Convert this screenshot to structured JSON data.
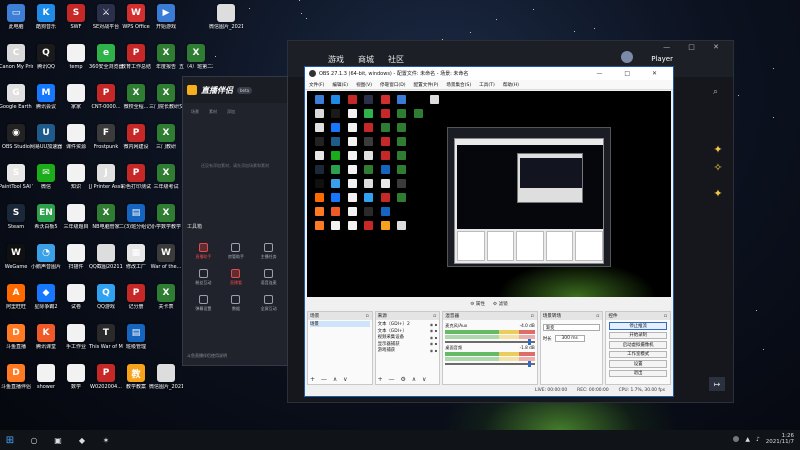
{
  "desktop": {
    "icons": [
      {
        "label": "此电脑",
        "color": "#3d7fd6",
        "glyph": "▭"
      },
      {
        "label": "酷狗音乐",
        "color": "#1e8be8",
        "glyph": "K"
      },
      {
        "label": "SWF",
        "color": "#c62828",
        "glyph": "S"
      },
      {
        "label": "SE对战平台",
        "color": "#2b2f4a",
        "glyph": "⚔"
      },
      {
        "label": "WPS Office",
        "color": "#d32f2f",
        "glyph": "W"
      },
      {
        "label": "开始游戏",
        "color": "#3a7bd5",
        "glyph": "▶"
      },
      {
        "label": "",
        "color": "#00000000",
        "glyph": ""
      },
      {
        "label": "微信图片_2021042...",
        "color": "#dddddd",
        "glyph": ""
      },
      {
        "label": "Canon My Printer",
        "color": "#d9d9d9",
        "glyph": "C"
      },
      {
        "label": "腾讯QQ",
        "color": "#1a1a1a",
        "glyph": "Q"
      },
      {
        "label": "temp",
        "color": "#f2f2f2",
        "glyph": ""
      },
      {
        "label": "360安全浏览器",
        "color": "#2fb24a",
        "glyph": "e"
      },
      {
        "label": "教育工作总结",
        "color": "#c62828",
        "glyph": "P"
      },
      {
        "label": "年度报告",
        "color": "#2e7d32",
        "glyph": "X"
      },
      {
        "label": "五（4）班第二次考试",
        "color": "#2e7d32",
        "glyph": "X"
      },
      {
        "label": "",
        "color": "#00000000",
        "glyph": ""
      },
      {
        "label": "Google Earth Pro",
        "color": "#e0e0e0",
        "glyph": "G"
      },
      {
        "label": "腾讯会议",
        "color": "#1677ff",
        "glyph": "M"
      },
      {
        "label": "家家",
        "color": "#f2f2f2",
        "glyph": ""
      },
      {
        "label": "CNT-0000...",
        "color": "#c62828",
        "glyph": "P"
      },
      {
        "label": "微校全程...",
        "color": "#2e7d32",
        "glyph": "X"
      },
      {
        "label": "三门院长教研交流",
        "color": "#2e7d32",
        "glyph": "X"
      },
      {
        "label": "",
        "color": "#00000000",
        "glyph": ""
      },
      {
        "label": "",
        "color": "#00000000",
        "glyph": ""
      },
      {
        "label": "OBS Studio",
        "color": "#222222",
        "glyph": "◉"
      },
      {
        "label": "网易UU加速器",
        "color": "#1e5a8a",
        "glyph": "U"
      },
      {
        "label": "课件资源",
        "color": "#f2f2f2",
        "glyph": ""
      },
      {
        "label": "Frostpunk",
        "color": "#3b3b3b",
        "glyph": "F"
      },
      {
        "label": "微内网建设",
        "color": "#c62828",
        "glyph": "P"
      },
      {
        "label": "三门教研",
        "color": "#2e7d32",
        "glyph": "X"
      },
      {
        "label": "",
        "color": "#00000000",
        "glyph": ""
      },
      {
        "label": "",
        "color": "#00000000",
        "glyph": ""
      },
      {
        "label": "PaintTool SAI Ver.1",
        "color": "#e7e7e7",
        "glyph": "S"
      },
      {
        "label": "微信",
        "color": "#1aad19",
        "glyph": "✉"
      },
      {
        "label": "知识",
        "color": "#f2f2f2",
        "glyph": ""
      },
      {
        "label": "JJ Printer Assista...",
        "color": "#e0e0e0",
        "glyph": "J"
      },
      {
        "label": "彩色打印测试",
        "color": "#c62828",
        "glyph": "P"
      },
      {
        "label": "三年级考试",
        "color": "#2e7d32",
        "glyph": "X"
      },
      {
        "label": "",
        "color": "#00000000",
        "glyph": ""
      },
      {
        "label": "",
        "color": "#00000000",
        "glyph": ""
      },
      {
        "label": "Steam",
        "color": "#1b2838",
        "glyph": "S"
      },
      {
        "label": "希沃白板5",
        "color": "#2ca04a",
        "glyph": "EN"
      },
      {
        "label": "三年级题目",
        "color": "#f2f2f2",
        "glyph": ""
      },
      {
        "label": "NB电脑管家",
        "color": "#2e7d32",
        "glyph": "X"
      },
      {
        "label": "二(3)班分组记录",
        "color": "#1565c0",
        "glyph": "▤"
      },
      {
        "label": "小学数学教学",
        "color": "#2e7d32",
        "glyph": "X"
      },
      {
        "label": "",
        "color": "#00000000",
        "glyph": ""
      },
      {
        "label": "",
        "color": "#00000000",
        "glyph": ""
      },
      {
        "label": "WeGame",
        "color": "#101010",
        "glyph": "W"
      },
      {
        "label": "小鹅声音图片",
        "color": "#3aa0e8",
        "glyph": "◔"
      },
      {
        "label": "扫描件",
        "color": "#f2f2f2",
        "glyph": ""
      },
      {
        "label": "QQ截图20211103...",
        "color": "#dddddd",
        "glyph": ""
      },
      {
        "label": "修改工厂",
        "color": "#e6e6e6",
        "glyph": "▦"
      },
      {
        "label": "War of the...",
        "color": "#3b3b3b",
        "glyph": "W"
      },
      {
        "label": "",
        "color": "#00000000",
        "glyph": ""
      },
      {
        "label": "",
        "color": "#00000000",
        "glyph": ""
      },
      {
        "label": "阿里旺旺",
        "color": "#ff6a00",
        "glyph": "A"
      },
      {
        "label": "星际争霸2",
        "color": "#1677ff",
        "glyph": "◆"
      },
      {
        "label": "试卷",
        "color": "#f2f2f2",
        "glyph": ""
      },
      {
        "label": "QQ游戏",
        "color": "#2fa3f2",
        "glyph": "Q"
      },
      {
        "label": "记分册",
        "color": "#c62828",
        "glyph": "P"
      },
      {
        "label": "关卡表",
        "color": "#2e7d32",
        "glyph": "X"
      },
      {
        "label": "",
        "color": "#00000000",
        "glyph": ""
      },
      {
        "label": "",
        "color": "#00000000",
        "glyph": ""
      },
      {
        "label": "斗鱼直播",
        "color": "#ff7a22",
        "glyph": "D"
      },
      {
        "label": "腾讯课堂",
        "color": "#f05a28",
        "glyph": "K"
      },
      {
        "label": "手工作业",
        "color": "#f2f2f2",
        "glyph": ""
      },
      {
        "label": "This War of Mine",
        "color": "#2a2a2a",
        "glyph": "T"
      },
      {
        "label": "班级管理",
        "color": "#1565c0",
        "glyph": "▤"
      },
      {
        "label": "",
        "color": "#00000000",
        "glyph": ""
      },
      {
        "label": "",
        "color": "#00000000",
        "glyph": ""
      },
      {
        "label": "",
        "color": "#00000000",
        "glyph": ""
      },
      {
        "label": "斗鱼直播伴侣",
        "color": "#ff7a22",
        "glyph": "D"
      },
      {
        "label": "shower",
        "color": "#f2f2f2",
        "glyph": ""
      },
      {
        "label": "数学",
        "color": "#f2f2f2",
        "glyph": ""
      },
      {
        "label": "W0202004...",
        "color": "#c62828",
        "glyph": "P"
      },
      {
        "label": "教学教案",
        "color": "#f7a21b",
        "glyph": "教"
      },
      {
        "label": "微信图片_2021042...",
        "color": "#dddddd",
        "glyph": ""
      },
      {
        "label": "",
        "color": "#00000000",
        "glyph": ""
      },
      {
        "label": "",
        "color": "#00000000",
        "glyph": ""
      }
    ]
  },
  "game": {
    "tabs": [
      "游戏",
      "商城",
      "社区"
    ],
    "player_name": "Player",
    "window_controls": "— □ ✕",
    "search_icon": "⌕",
    "send_glyph": "↦"
  },
  "live_assistant": {
    "title": "直播伴侣",
    "version": "beta",
    "sub_tabs": [
      "场景",
      "素材",
      "添加"
    ],
    "empty_hint": "还没有添加素材，请先添加场景和素材",
    "tools_heading": "工具箱",
    "tools": [
      {
        "label": "直播助手",
        "active": true
      },
      {
        "label": "房管助手",
        "active": false
      },
      {
        "label": "主播任务",
        "active": false
      },
      {
        "label": "粉丝互动",
        "active": false
      },
      {
        "label": "直播看",
        "active": true
      },
      {
        "label": "语音连麦",
        "active": false
      },
      {
        "label": "弹幕设置",
        "active": false
      },
      {
        "label": "数据",
        "active": false
      },
      {
        "label": "全屏互动",
        "active": false
      }
    ],
    "footer": "斗鱼直播伴侣使用说明"
  },
  "obs": {
    "title": "OBS 27.1.3 (64-bit, windows) - 配置文件: 未命名 - 场景: 未命名",
    "menu": [
      "文件(F)",
      "编辑(E)",
      "视图(V)",
      "停靠窗口(D)",
      "配置文件(P)",
      "场景集合(S)",
      "工具(T)",
      "帮助(H)"
    ],
    "window_controls": "— □ ✕",
    "dock_bar": [
      "⚙ 属性",
      "⚙ 滤镜"
    ],
    "scenes": {
      "header": "场景",
      "items": [
        "场景"
      ]
    },
    "sources": {
      "header": "来源",
      "items": [
        "文本（GDI+）2",
        "文本（GDI+）",
        "视频采集设备",
        "显示器捕获",
        "游戏捕获"
      ]
    },
    "mixer": {
      "header": "混音器",
      "channels": [
        {
          "name": "麦克风/Aux",
          "db": "-4.0 dB"
        },
        {
          "name": "桌面音频",
          "db": "-1.8 dB"
        }
      ]
    },
    "transitions": {
      "header": "场景转场",
      "selected": "渐变",
      "duration_label": "时长",
      "duration_value": "300 ms"
    },
    "controls": {
      "header": "控件",
      "buttons": [
        "停止推流",
        "开始录制",
        "启动虚拟摄像机",
        "工作室模式",
        "设置",
        "退出"
      ]
    },
    "status": {
      "live": "LIVE: 00:00:00",
      "rec": "REC: 00:00:00",
      "cpu": "CPU: 1.7%, 30.00 fps"
    },
    "dock_footer": "+ — ∧ ∨"
  },
  "taskbar": {
    "items": [
      {
        "name": "start-button",
        "glyph": "⊞"
      },
      {
        "name": "search-icon",
        "glyph": "○"
      },
      {
        "name": "task-view-icon",
        "glyph": "▣"
      },
      {
        "name": "live-assistant-taskbar-icon",
        "glyph": "◆"
      },
      {
        "name": "game-taskbar-icon",
        "glyph": "✶"
      }
    ],
    "time": "1:26",
    "date": "2021/11/7"
  },
  "side_icons": [
    "✦",
    "✧",
    "✦"
  ]
}
